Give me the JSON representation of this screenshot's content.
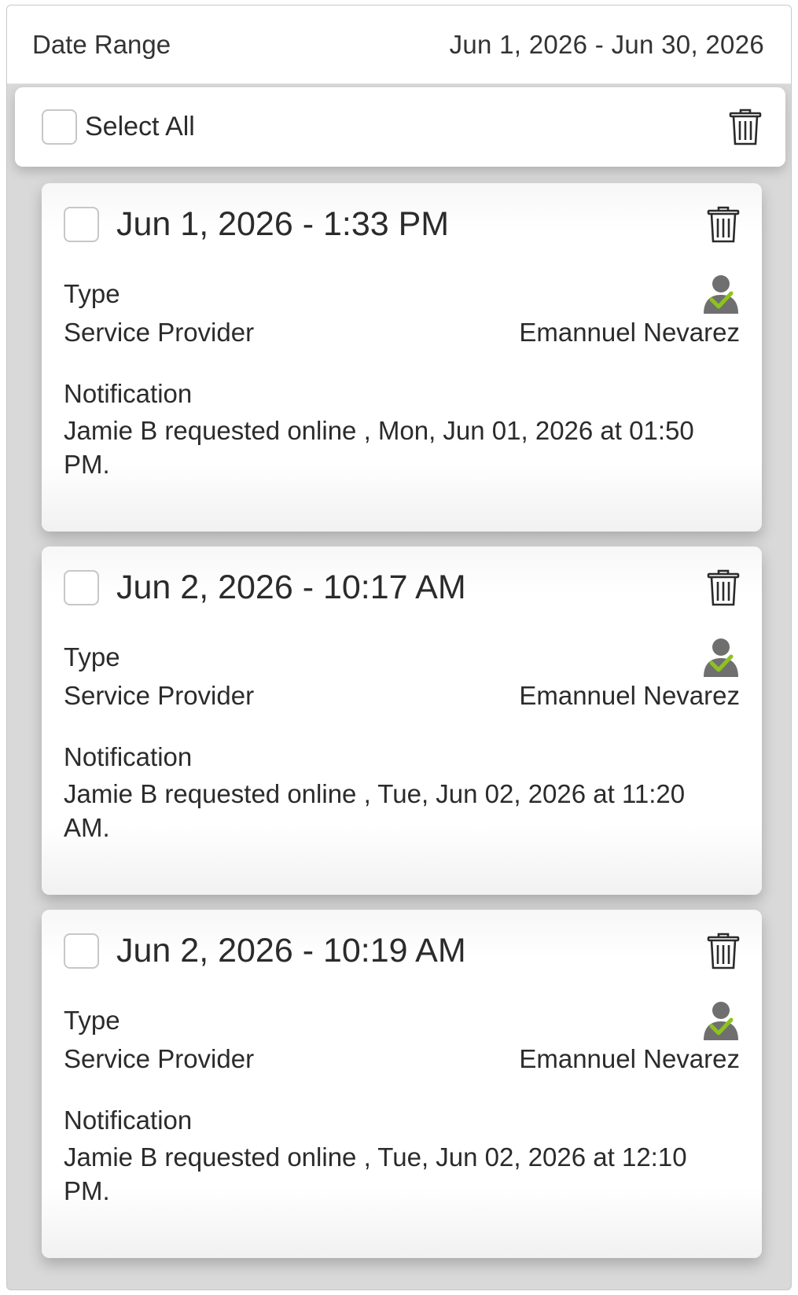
{
  "header": {
    "label": "Date Range",
    "value": "Jun 1, 2026 - Jun 30, 2026"
  },
  "select_all": {
    "label": "Select All",
    "checked": false
  },
  "icons": {
    "delete": "trash-icon",
    "type": "user-check-icon",
    "check_color": "#8dc21f"
  },
  "cards": [
    {
      "title": "Jun 1, 2026 - 1:33 PM",
      "type_label": "Type",
      "provider_label": "Service Provider",
      "provider_value": "Emannuel Nevarez",
      "notification_label": "Notification",
      "notification_text": "Jamie B requested online , Mon, Jun 01, 2026 at 01:50 PM."
    },
    {
      "title": "Jun 2, 2026 - 10:17 AM",
      "type_label": "Type",
      "provider_label": "Service Provider",
      "provider_value": "Emannuel Nevarez",
      "notification_label": "Notification",
      "notification_text": "Jamie B requested online , Tue, Jun 02, 2026 at 11:20 AM."
    },
    {
      "title": "Jun 2, 2026 - 10:19 AM",
      "type_label": "Type",
      "provider_label": "Service Provider",
      "provider_value": "Emannuel Nevarez",
      "notification_label": "Notification",
      "notification_text": "Jamie B requested online , Tue, Jun 02, 2026 at 12:10 PM."
    }
  ]
}
